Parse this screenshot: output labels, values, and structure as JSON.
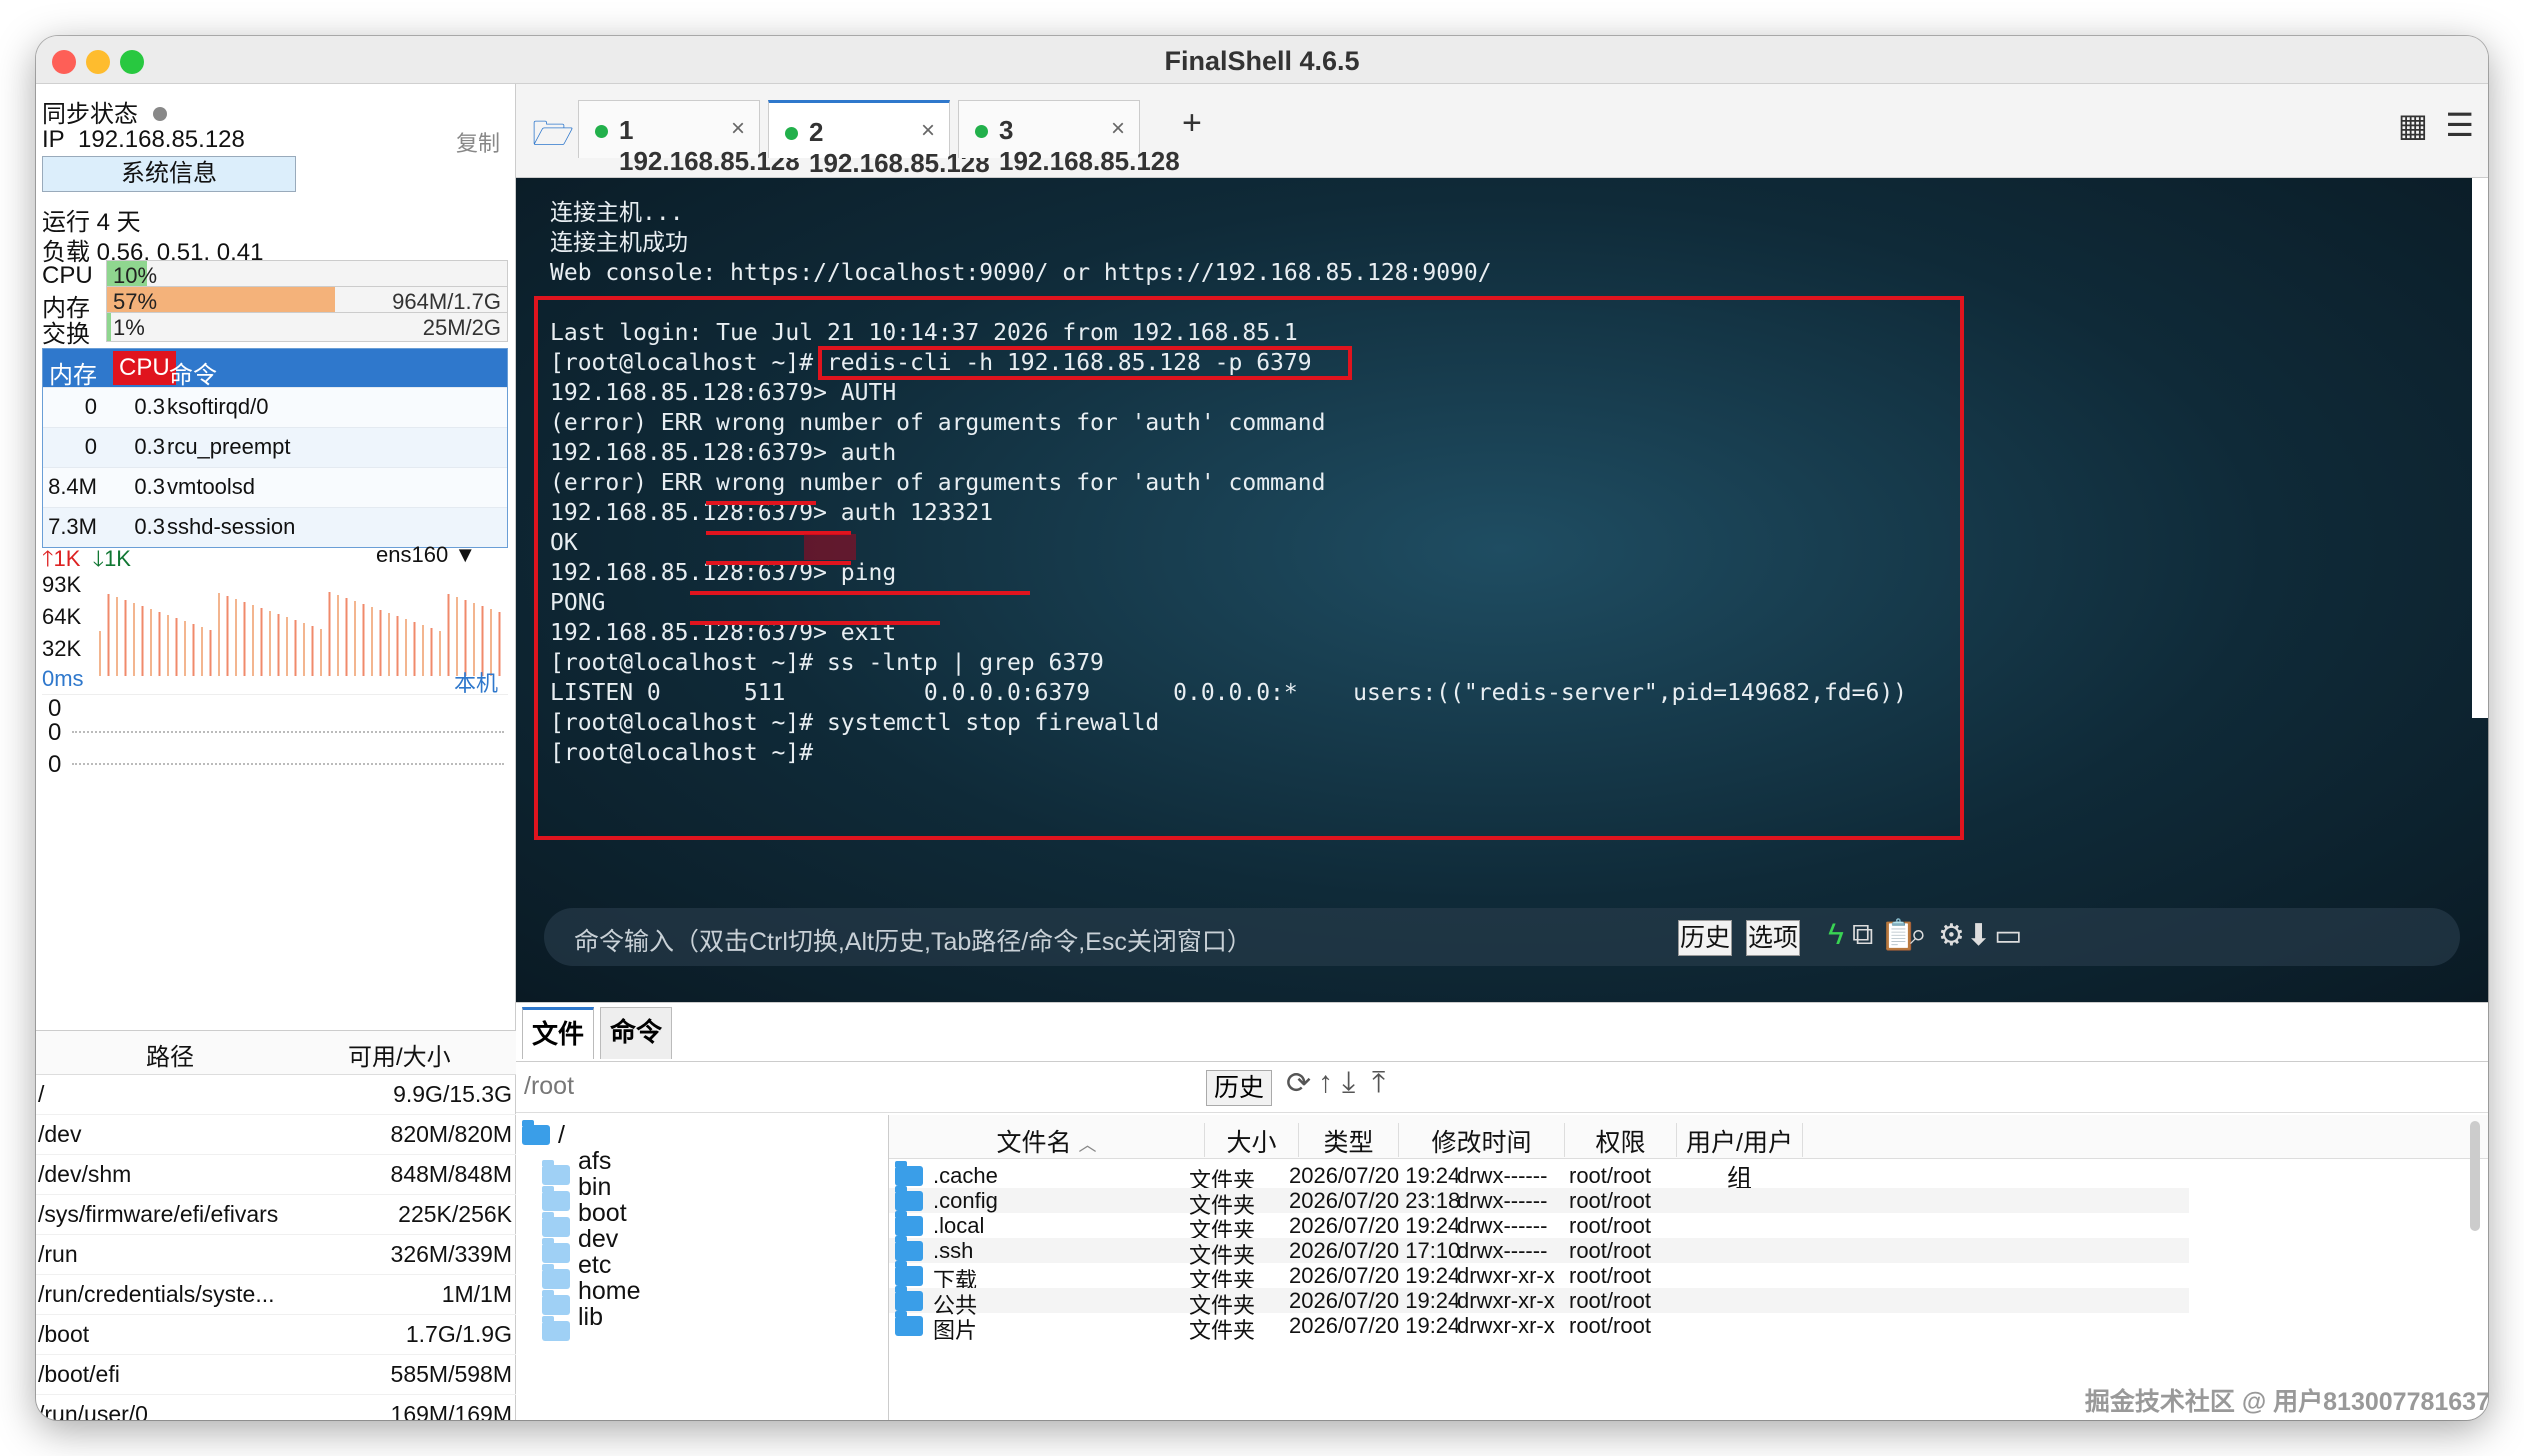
{
  "window": {
    "title": "FinalShell 4.6.5"
  },
  "left": {
    "sync_label": "同步状态",
    "ip_label": "IP",
    "ip": "192.168.85.128",
    "copy": "复制",
    "sysinfo_button": "系统信息",
    "uptime": "运行 4 天",
    "load": "负载 0.56, 0.51, 0.41",
    "cpu": {
      "label": "CPU",
      "value": "10%",
      "fraction": 0.1
    },
    "mem": {
      "label": "内存",
      "value": "57%",
      "detail": "964M/1.7G",
      "fraction": 0.57
    },
    "swap": {
      "label": "交换",
      "value": "1%",
      "detail": "25M/2G",
      "fraction": 0.01
    },
    "proc_headers": [
      "内存",
      "CPU",
      "命令"
    ],
    "procs": [
      {
        "mem": "0",
        "cpu": "0.3",
        "cmd": "ksoftirqd/0"
      },
      {
        "mem": "0",
        "cpu": "0.3",
        "cmd": "rcu_preempt"
      },
      {
        "mem": "8.4M",
        "cpu": "0.3",
        "cmd": "vmtoolsd"
      },
      {
        "mem": "7.3M",
        "cpu": "0.3",
        "cmd": "sshd-session"
      }
    ],
    "net": {
      "up": "1K",
      "down": "1K",
      "iface": "ens160",
      "y_labels": [
        "93K",
        "64K",
        "32K"
      ]
    },
    "ping": {
      "label": "0ms",
      "host": "本机",
      "values": [
        "0",
        "0",
        "0"
      ]
    },
    "disk_headers": [
      "路径",
      "可用/大小"
    ],
    "disks": [
      {
        "path": "/",
        "size": "9.9G/15.3G"
      },
      {
        "path": "/dev",
        "size": "820M/820M"
      },
      {
        "path": "/dev/shm",
        "size": "848M/848M"
      },
      {
        "path": "/sys/firmware/efi/efivars",
        "size": "225K/256K"
      },
      {
        "path": "/run",
        "size": "326M/339M"
      },
      {
        "path": "/run/credentials/syste...",
        "size": "1M/1M"
      },
      {
        "path": "/boot",
        "size": "1.7G/1.9G"
      },
      {
        "path": "/boot/efi",
        "size": "585M/598M"
      },
      {
        "path": "/run/user/0",
        "size": "169M/169M"
      }
    ]
  },
  "tabs": [
    {
      "label": "1 192.168.85.128",
      "close": "×"
    },
    {
      "label": "2 192.168.85.128",
      "close": "×"
    },
    {
      "label": "3 192.168.85.128",
      "close": "×"
    }
  ],
  "add_tab": "+",
  "terminal": {
    "lines": [
      "连接主机...",
      "连接主机成功",
      "Web console: https://localhost:9090/ or https://192.168.85.128:9090/",
      "",
      "Last login: Tue Jul 21 10:14:37 2026 from 192.168.85.1",
      "[root@localhost ~]# redis-cli -h 192.168.85.128 -p 6379",
      "192.168.85.128:6379> AUTH",
      "(error) ERR wrong number of arguments for 'auth' command",
      "192.168.85.128:6379> auth",
      "(error) ERR wrong number of arguments for 'auth' command",
      "192.168.85.128:6379> auth 123321",
      "OK",
      "192.168.85.128:6379> ping",
      "PONG",
      "192.168.85.128:6379> exit",
      "[root@localhost ~]# ss -lntp | grep 6379",
      "LISTEN 0      511          0.0.0.0:6379      0.0.0.0:*    users:((\"redis-server\",pid=149682,fd=6))",
      "[root@localhost ~]# systemctl stop firewalld",
      "[root@localhost ~]#"
    ],
    "cmd_placeholder": "命令输入（双击Ctrl切换,Alt历史,Tab路径/命令,Esc关闭窗口）",
    "history_button": "历史",
    "options_button": "选项"
  },
  "bottom": {
    "tab_files": "文件",
    "tab_commands": "命令",
    "path": "/root",
    "history_button": "历史",
    "tree": [
      "/",
      "afs",
      "bin",
      "boot",
      "dev",
      "etc",
      "home",
      "lib"
    ],
    "file_headers": [
      "文件名",
      "大小",
      "类型",
      "修改时间",
      "权限",
      "用户/用户组"
    ],
    "files": [
      {
        "name": ".cache",
        "size": "",
        "type": "文件夹",
        "mtime": "2026/07/20 19:24",
        "perm": "drwx------",
        "owner": "root/root"
      },
      {
        "name": ".config",
        "size": "",
        "type": "文件夹",
        "mtime": "2026/07/20 23:18",
        "perm": "drwx------",
        "owner": "root/root"
      },
      {
        "name": ".local",
        "size": "",
        "type": "文件夹",
        "mtime": "2026/07/20 19:24",
        "perm": "drwx------",
        "owner": "root/root"
      },
      {
        "name": ".ssh",
        "size": "",
        "type": "文件夹",
        "mtime": "2026/07/20 17:10",
        "perm": "drwx------",
        "owner": "root/root"
      },
      {
        "name": "下载",
        "size": "",
        "type": "文件夹",
        "mtime": "2026/07/20 19:24",
        "perm": "drwxr-xr-x",
        "owner": "root/root"
      },
      {
        "name": "公共",
        "size": "",
        "type": "文件夹",
        "mtime": "2026/07/20 19:24",
        "perm": "drwxr-xr-x",
        "owner": "root/root"
      },
      {
        "name": "图片",
        "size": "",
        "type": "文件夹",
        "mtime": "2026/07/20 19:24",
        "perm": "drwxr-xr-x",
        "owner": "root/root"
      }
    ]
  },
  "watermark": "掘金技术社区 @ 用户813007781637",
  "colors": {
    "accent": "#2f78cc",
    "highlight_red": "#e0141e",
    "cpu_bar": "#8fd68f",
    "mem_bar": "#f4b27a"
  }
}
